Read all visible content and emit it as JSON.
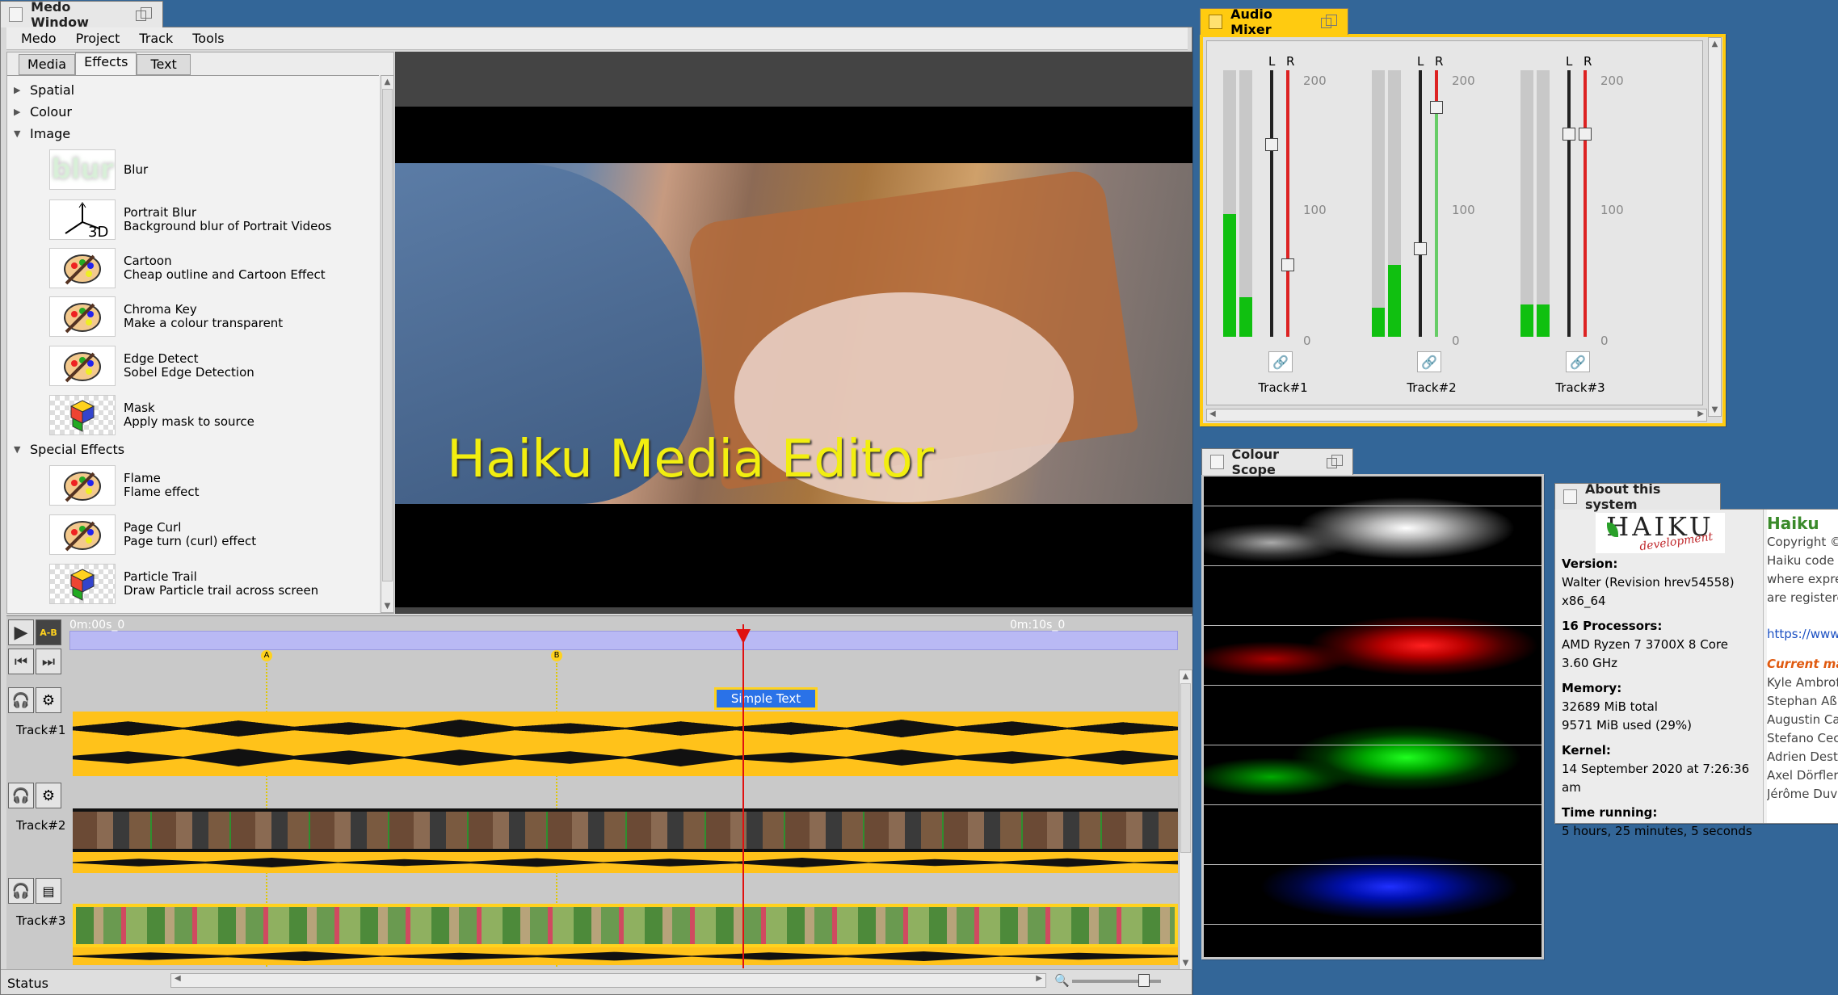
{
  "medo": {
    "title": "Medo Window",
    "menu": [
      "Medo",
      "Project",
      "Track",
      "Tools"
    ],
    "tabs": [
      "Media",
      "Effects",
      "Text"
    ],
    "categories": {
      "spatial": "Spatial",
      "colour": "Colour",
      "image": "Image",
      "special": "Special Effects"
    },
    "effects": [
      {
        "name": "Blur",
        "desc": ""
      },
      {
        "name": "Portrait Blur",
        "desc": "Background blur of Portrait Videos"
      },
      {
        "name": "Cartoon",
        "desc": "Cheap outline and Cartoon Effect"
      },
      {
        "name": "Chroma Key",
        "desc": "Make a colour transparent"
      },
      {
        "name": "Edge Detect",
        "desc": "Sobel Edge Detection"
      },
      {
        "name": "Mask",
        "desc": "Apply mask to source"
      },
      {
        "name": "Flame",
        "desc": "Flame effect"
      },
      {
        "name": "Page Curl",
        "desc": "Page turn (curl) effect"
      },
      {
        "name": "Particle Trail",
        "desc": "Draw Particle trail across screen"
      }
    ],
    "thumb_blur_text": "blur",
    "thumb_3d_text": "3D",
    "preview_title": "Haiku Media Editor",
    "timeline": {
      "start": "0m:00s_0",
      "mid": "0m:10s_0",
      "marker_a": "A",
      "marker_b": "B",
      "ab": "A-B",
      "text_clip": "Simple Text",
      "tracks": [
        "Track#1",
        "Track#2",
        "Track#3"
      ]
    },
    "status": "Status"
  },
  "mixer": {
    "title": "Audio Mixer",
    "l": "L",
    "r": "R",
    "scale": [
      "200",
      "100",
      "0"
    ],
    "channels": [
      {
        "name": "Track#1",
        "meter_l": 0.46,
        "meter_r": 0.15,
        "fader_l": 0.72,
        "fader_r": 0.27
      },
      {
        "name": "Track#2",
        "meter_l": 0.11,
        "meter_r": 0.27,
        "fader_l": 0.33,
        "fader_r": 0.86
      },
      {
        "name": "Track#3",
        "meter_l": 0.12,
        "meter_r": 0.12,
        "fader_l": 0.76,
        "fader_r": 0.76
      }
    ]
  },
  "scope": {
    "title": "Colour Scope"
  },
  "about": {
    "title": "About this system",
    "logo": "HAIKU",
    "logo_sub": "development",
    "version_label": "Version:",
    "version": "Walter (Revision hrev54558)",
    "arch": "x86_64",
    "cpu_label": "16 Processors:",
    "cpu": "AMD Ryzen 7 3700X 8 Core",
    "ghz": "3.60 GHz",
    "mem_label": "Memory:",
    "mem_total": "32689 MiB total",
    "mem_used": "9571 MiB used (29%)",
    "kernel_label": "Kernel:",
    "kernel": "14 September 2020 at 7:26:36 am",
    "uptime_label": "Time running:",
    "uptime": "5 hours, 25 minutes, 5 seconds",
    "right_title": "Haiku",
    "right_lines": [
      "Copyright ©",
      "Haiku code i",
      "where expre",
      "are registere"
    ],
    "right_url": "https://www",
    "maint_label": "Current mai",
    "names": [
      "Kyle Ambrof",
      "Stephan Aß",
      "Augustin Ca",
      "Stefano Cec",
      "Adrien Dest",
      "Axel Dörfler",
      "Jérôme Duv"
    ]
  }
}
